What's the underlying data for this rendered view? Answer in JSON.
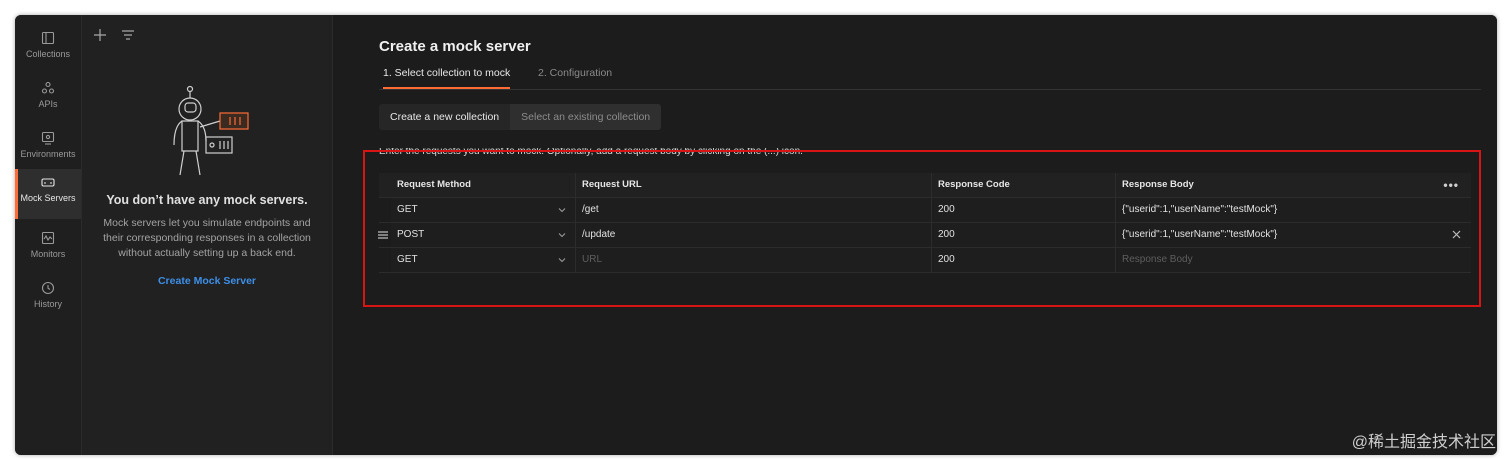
{
  "rail": {
    "items": [
      {
        "label": "Collections",
        "icon": "collections-icon"
      },
      {
        "label": "APIs",
        "icon": "apis-icon"
      },
      {
        "label": "Environments",
        "icon": "environments-icon"
      },
      {
        "label": "Mock Servers",
        "icon": "mock-servers-icon",
        "active": true
      },
      {
        "label": "Monitors",
        "icon": "monitors-icon"
      },
      {
        "label": "History",
        "icon": "history-icon"
      }
    ]
  },
  "sidebar": {
    "empty_title": "You don’t have any mock servers.",
    "empty_desc": "Mock servers let you simulate endpoints and their corresponding responses in a collection without actually setting up a back end.",
    "create_link": "Create Mock Server"
  },
  "main": {
    "title": "Create a mock server",
    "steps": [
      "1.  Select collection to mock",
      "2.  Configuration"
    ],
    "segment": [
      "Create a new collection",
      "Select an existing collection"
    ],
    "instructions": "Enter the requests you want to mock. Optionally, add a request body by clicking on the (...) icon.",
    "table": {
      "headers": [
        "Request Method",
        "Request URL",
        "Response Code",
        "Response Body"
      ],
      "rows": [
        {
          "method": "GET",
          "url": "/get",
          "code": "200",
          "body": "{\"userid\":1,\"userName\":\"testMock\"}"
        },
        {
          "method": "POST",
          "url": "/update",
          "code": "200",
          "body": "{\"userid\":1,\"userName\":\"testMock\"}"
        },
        {
          "method": "GET",
          "url_placeholder": "URL",
          "code": "200",
          "body_placeholder": "Response Body"
        }
      ]
    }
  },
  "watermark": "@稀土掘金技术社区",
  "colors": {
    "accent": "#ff6c37",
    "link": "#3d8fe8",
    "highlight": "#d81414"
  }
}
